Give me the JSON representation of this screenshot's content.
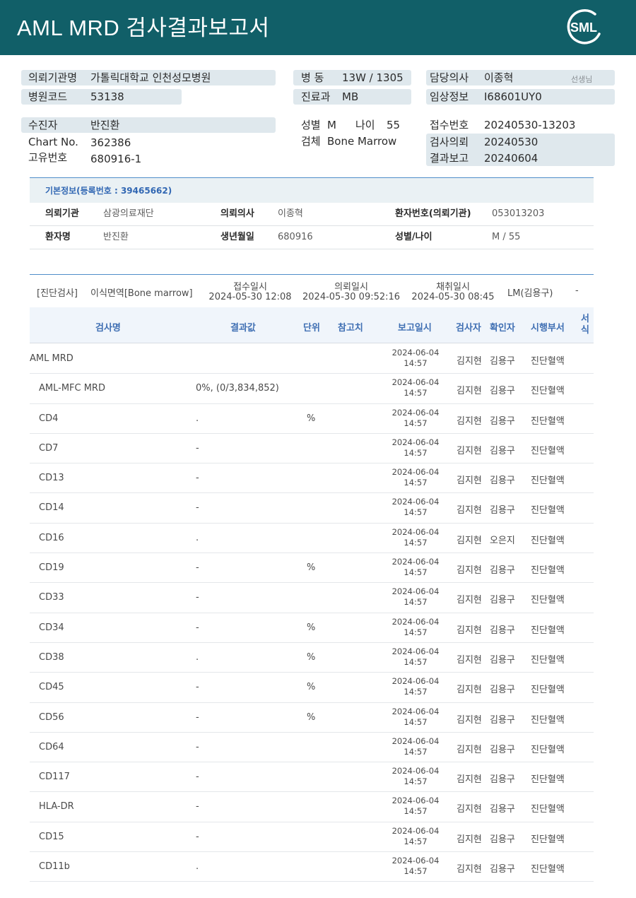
{
  "header": {
    "title": "AML  MRD 검사결과보고서",
    "logo_text": "SML"
  },
  "info": {
    "hospital_label": "의뢰기관명",
    "hospital": "가톨릭대학교 인천성모병원",
    "code_label": "병원코드",
    "code": "53138",
    "ward_label": "병  동",
    "ward": "13W / 1305",
    "dept_label": "진료과",
    "dept": "MB",
    "doctor_label": "담당의사",
    "doctor": "이종혁",
    "doctor_suffix": "선생님",
    "clinical_label": "임상정보",
    "clinical": "I68601UY0",
    "patient_label": "수진자",
    "patient": "반진환",
    "chart_label": "Chart No.",
    "chart": "362386",
    "unique_label": "고유번호",
    "unique": "680916-1",
    "sex_label": "성별",
    "sex": "M",
    "age_label": "나이",
    "age": "55",
    "specimen_label": "검체",
    "specimen": "Bone Marrow",
    "receipt_label": "접수번호",
    "receipt": "20240530-13203",
    "request_label": "검사의뢰",
    "request": "20240530",
    "report_label": "결과보고",
    "report": "20240604"
  },
  "basic": {
    "title": "기본정보(등록번호 : 39465662)",
    "rows": [
      [
        {
          "k": "의뢰기관",
          "v": "삼광의료재단"
        },
        {
          "k": "의뢰의사",
          "v": "이종혁"
        },
        {
          "k": "환자번호(의뢰기관)",
          "v": "053013203"
        }
      ],
      [
        {
          "k": "환자명",
          "v": "반진환"
        },
        {
          "k": "생년월일",
          "v": "680916"
        },
        {
          "k": "성별/나이",
          "v": "M / 55"
        }
      ]
    ]
  },
  "diagnosis": {
    "category": "[진단검사]",
    "specimen": "이식면역[Bone marrow]",
    "receipt_label": "접수일시",
    "receipt_time": "2024-05-30 12:08",
    "request_label": "의뢰일시",
    "request_time": "2024-05-30 09:52:16",
    "collect_label": "채취일시",
    "collect_time": "2024-05-30 08:45",
    "staff": "LM(김용구)",
    "extra": "-"
  },
  "table": {
    "headers": [
      "검사명",
      "결과값",
      "단위",
      "참고치",
      "보고일시",
      "검사자",
      "확인자",
      "시행부서",
      "서식"
    ],
    "rows": [
      {
        "name": "AML MRD",
        "indent": false,
        "result": "",
        "unit": "",
        "date": "2024-06-04",
        "time": "14:57",
        "tester": "김지현",
        "confirmer": "김용구",
        "dept": "진단혈액"
      },
      {
        "name": "AML-MFC MRD",
        "indent": true,
        "result": "0%, (0/3,834,852)",
        "unit": "",
        "date": "2024-06-04",
        "time": "14:57",
        "tester": "김지현",
        "confirmer": "김용구",
        "dept": "진단혈액"
      },
      {
        "name": "CD4",
        "indent": true,
        "result": ".",
        "unit": "%",
        "date": "2024-06-04",
        "time": "14:57",
        "tester": "김지현",
        "confirmer": "김용구",
        "dept": "진단혈액"
      },
      {
        "name": "CD7",
        "indent": true,
        "result": "-",
        "unit": "",
        "date": "2024-06-04",
        "time": "14:57",
        "tester": "김지현",
        "confirmer": "김용구",
        "dept": "진단혈액"
      },
      {
        "name": "CD13",
        "indent": true,
        "result": "-",
        "unit": "",
        "date": "2024-06-04",
        "time": "14:57",
        "tester": "김지현",
        "confirmer": "김용구",
        "dept": "진단혈액"
      },
      {
        "name": "CD14",
        "indent": true,
        "result": "-",
        "unit": "",
        "date": "2024-06-04",
        "time": "14:57",
        "tester": "김지현",
        "confirmer": "김용구",
        "dept": "진단혈액"
      },
      {
        "name": "CD16",
        "indent": true,
        "result": ".",
        "unit": "",
        "date": "2024-06-04",
        "time": "14:57",
        "tester": "김지현",
        "confirmer": "오은지",
        "dept": "진단혈액"
      },
      {
        "name": "CD19",
        "indent": true,
        "result": "-",
        "unit": "%",
        "date": "2024-06-04",
        "time": "14:57",
        "tester": "김지현",
        "confirmer": "김용구",
        "dept": "진단혈액"
      },
      {
        "name": "CD33",
        "indent": true,
        "result": "-",
        "unit": "",
        "date": "2024-06-04",
        "time": "14:57",
        "tester": "김지현",
        "confirmer": "김용구",
        "dept": "진단혈액"
      },
      {
        "name": "CD34",
        "indent": true,
        "result": "-",
        "unit": "%",
        "date": "2024-06-04",
        "time": "14:57",
        "tester": "김지현",
        "confirmer": "김용구",
        "dept": "진단혈액"
      },
      {
        "name": "CD38",
        "indent": true,
        "result": ".",
        "unit": "%",
        "date": "2024-06-04",
        "time": "14:57",
        "tester": "김지현",
        "confirmer": "김용구",
        "dept": "진단혈액"
      },
      {
        "name": "CD45",
        "indent": true,
        "result": "-",
        "unit": "%",
        "date": "2024-06-04",
        "time": "14:57",
        "tester": "김지현",
        "confirmer": "김용구",
        "dept": "진단혈액"
      },
      {
        "name": "CD56",
        "indent": true,
        "result": "-",
        "unit": "%",
        "date": "2024-06-04",
        "time": "14:57",
        "tester": "김지현",
        "confirmer": "김용구",
        "dept": "진단혈액"
      },
      {
        "name": "CD64",
        "indent": true,
        "result": "-",
        "unit": "",
        "date": "2024-06-04",
        "time": "14:57",
        "tester": "김지현",
        "confirmer": "김용구",
        "dept": "진단혈액"
      },
      {
        "name": "CD117",
        "indent": true,
        "result": "-",
        "unit": "",
        "date": "2024-06-04",
        "time": "14:57",
        "tester": "김지현",
        "confirmer": "김용구",
        "dept": "진단혈액"
      },
      {
        "name": "HLA-DR",
        "indent": true,
        "result": "-",
        "unit": "",
        "date": "2024-06-04",
        "time": "14:57",
        "tester": "김지현",
        "confirmer": "김용구",
        "dept": "진단혈액"
      },
      {
        "name": "CD15",
        "indent": true,
        "result": "-",
        "unit": "",
        "date": "2024-06-04",
        "time": "14:57",
        "tester": "김지현",
        "confirmer": "김용구",
        "dept": "진단혈액"
      },
      {
        "name": "CD11b",
        "indent": true,
        "result": ".",
        "unit": "",
        "date": "2024-06-04",
        "time": "14:57",
        "tester": "김지현",
        "confirmer": "김용구",
        "dept": "진단혈액"
      }
    ]
  }
}
